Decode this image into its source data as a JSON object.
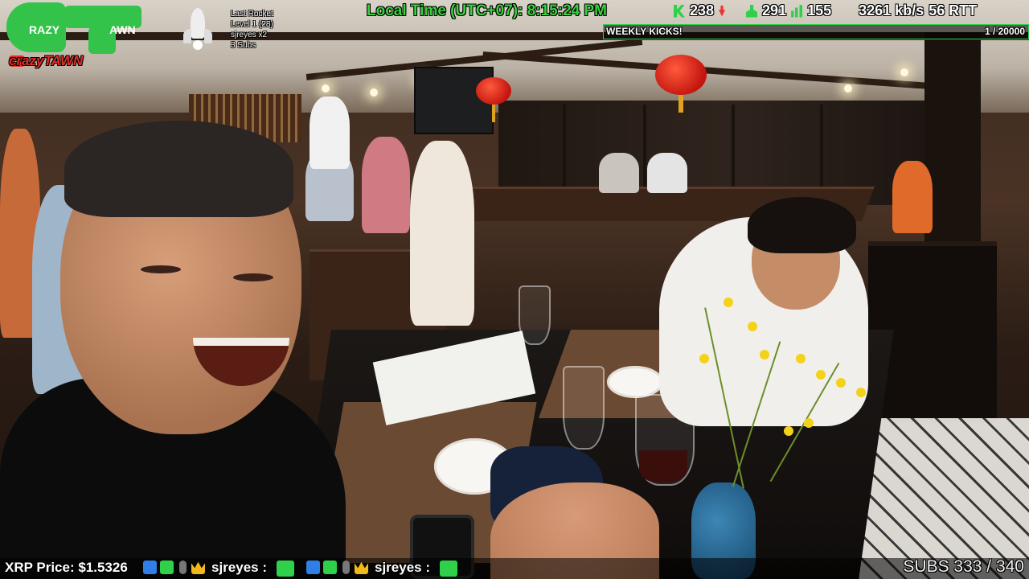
{
  "brand": {
    "logo_left": "RAZY",
    "logo_right": "AWN",
    "youtube_channel": "crazyTAWN"
  },
  "rocket": {
    "title": "Last Rocket",
    "level": "Level 1  (28)",
    "user": "sjreyes x2",
    "subs": "3 Subs"
  },
  "clock": {
    "text": "Local Time (UTC+07): 8:15:24 PM"
  },
  "stats": {
    "kick_count": "238",
    "followers": "291",
    "viewers": "155",
    "bitrate": "3261 kb/s",
    "rtt": "56 RTT"
  },
  "goal": {
    "label": "WEEKLY KICKS!",
    "count": "1 / 20000",
    "progress_fraction": 5e-05
  },
  "ticker": {
    "price": "XRP Price: $1.5326",
    "user_1": "sjreyes :",
    "user_2": "sjreyes :"
  },
  "subs_goal": {
    "text": "SUBS 333 / 340"
  },
  "colors": {
    "brand_green": "#33c24a",
    "youtube_red": "#e52d27",
    "clock_green": "#3ad03e"
  }
}
